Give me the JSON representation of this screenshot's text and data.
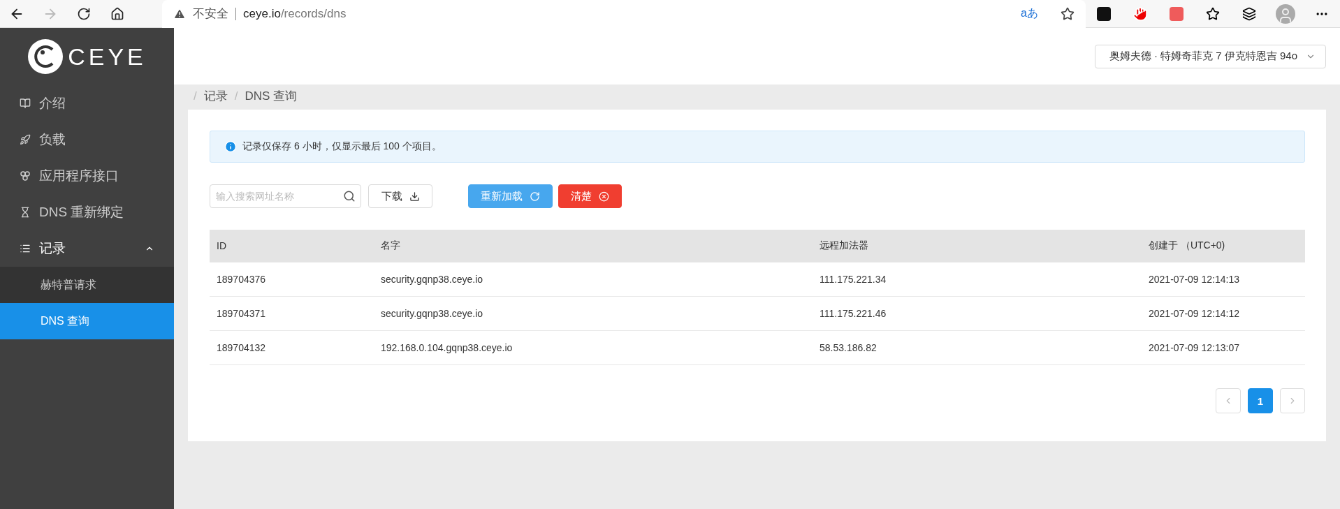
{
  "browser": {
    "security": "不安全",
    "host": "ceye.io",
    "path": "/records/dns",
    "translate": "aあ"
  },
  "sidebar": {
    "logo": "CEYE",
    "items": [
      {
        "label": "介绍",
        "expanded": false,
        "selected": false
      },
      {
        "label": "负载",
        "expanded": false,
        "selected": false
      },
      {
        "label": "应用程序接口",
        "expanded": false,
        "selected": false
      },
      {
        "label": "DNS 重新绑定",
        "expanded": false,
        "selected": false
      },
      {
        "label": "记录",
        "expanded": true,
        "selected": false,
        "children": [
          {
            "label": "赫特普请求",
            "selected": false
          },
          {
            "label": "DNS 查询",
            "selected": true
          }
        ]
      }
    ]
  },
  "user_menu": {
    "label": "奥姆夫德 · 特姆奇菲克 7 伊克特恩吉 94o"
  },
  "breadcrumb": [
    {
      "separator": "/",
      "label": "记录"
    },
    {
      "separator": "/",
      "label": "DNS 查询"
    }
  ],
  "alert": {
    "text": "记录仅保存 6 小时，仅显示最后 100 个项目。"
  },
  "search": {
    "placeholder": "输入搜索网址名称"
  },
  "buttons": [
    {
      "label": "下载",
      "kind": "download"
    },
    {
      "label": "重新加载",
      "kind": "reload"
    },
    {
      "label": "清楚",
      "kind": "clear"
    }
  ],
  "table": {
    "columns": [
      "ID",
      "名字",
      "远程加法器",
      "创建于 （UTC+0)"
    ],
    "rows": [
      [
        "189704376",
        "security.gqnp38.ceye.io",
        "111.175.221.34",
        "2021-07-09 12:14:13"
      ],
      [
        "189704371",
        "security.gqnp38.ceye.io",
        "111.175.221.46",
        "2021-07-09 12:14:12"
      ],
      [
        "189704132",
        "192.168.0.104.gqnp38.ceye.io",
        "58.53.186.82",
        "2021-07-09 12:13:07"
      ]
    ]
  },
  "pagination": {
    "pages": [
      {
        "label": "1",
        "selected": true
      }
    ]
  }
}
